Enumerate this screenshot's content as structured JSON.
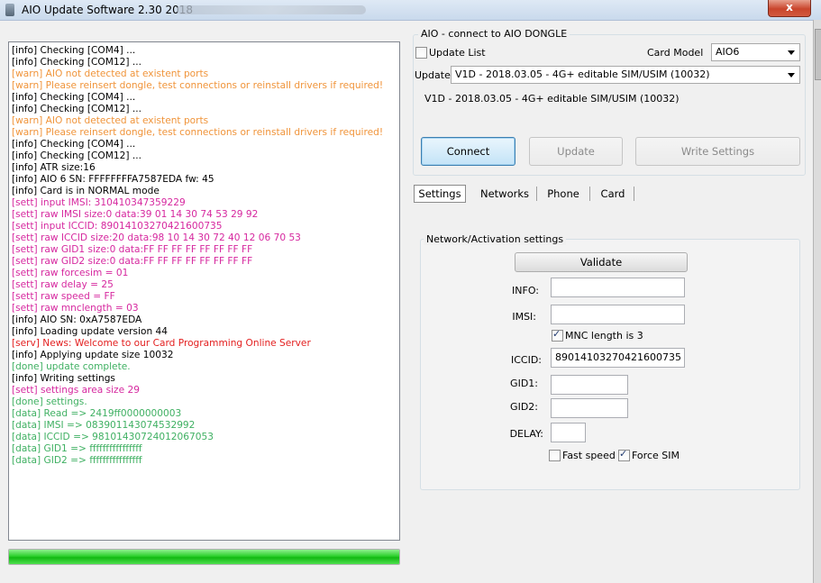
{
  "window": {
    "title": "AIO Update Software 2.30 2018",
    "close_label": "x"
  },
  "log": {
    "lines": [
      {
        "text": "[info] Checking [COM4] ...",
        "kind": "info"
      },
      {
        "text": "[info] Checking [COM12] ...",
        "kind": "info"
      },
      {
        "text": "[warn] AIO not detected at existent ports",
        "kind": "warn"
      },
      {
        "text": "[warn] Please reinsert dongle, test connections or reinstall drivers if required!",
        "kind": "warn"
      },
      {
        "text": "[info] Checking [COM4] ...",
        "kind": "info"
      },
      {
        "text": "[info] Checking [COM12] ...",
        "kind": "info"
      },
      {
        "text": "[warn] AIO not detected at existent ports",
        "kind": "warn"
      },
      {
        "text": "[warn] Please reinsert dongle, test connections or reinstall drivers if required!",
        "kind": "warn"
      },
      {
        "text": "[info] Checking [COM4] ...",
        "kind": "info"
      },
      {
        "text": "[info] Checking [COM12] ...",
        "kind": "info"
      },
      {
        "text": "[info] ATR size:16",
        "kind": "info"
      },
      {
        "text": "[info] AIO 6 SN: FFFFFFFFA7587EDA fw: 45",
        "kind": "info"
      },
      {
        "text": "[info] Card is in NORMAL mode",
        "kind": "info"
      },
      {
        "text": "[sett] input IMSI: 310410347359229",
        "kind": "sett"
      },
      {
        "text": "[sett] raw IMSI size:0 data:39 01 14 30 74 53 29 92",
        "kind": "sett"
      },
      {
        "text": "[sett] input ICCID: 89014103270421600735",
        "kind": "sett"
      },
      {
        "text": "[sett] raw ICCID size:20 data:98 10 14 30 72 40 12 06 70 53",
        "kind": "sett"
      },
      {
        "text": "[sett] raw GID1 size:0 data:FF FF FF FF FF FF FF FF",
        "kind": "sett"
      },
      {
        "text": "[sett] raw GID2 size:0 data:FF FF FF FF FF FF FF FF",
        "kind": "sett"
      },
      {
        "text": "[sett] raw forcesim = 01",
        "kind": "sett"
      },
      {
        "text": "[sett] raw delay = 25",
        "kind": "sett"
      },
      {
        "text": "[sett] raw speed = FF",
        "kind": "sett"
      },
      {
        "text": "[sett] raw mnclength = 03",
        "kind": "sett"
      },
      {
        "text": "[info] AIO SN: 0xA7587EDA",
        "kind": "info"
      },
      {
        "text": "[info] Loading update version 44",
        "kind": "info"
      },
      {
        "text": "[serv] News: Welcome to our Card Programming Online Server",
        "kind": "serv"
      },
      {
        "text": "[info] Applying update size 10032",
        "kind": "info"
      },
      {
        "text": "[done] update complete.",
        "kind": "done"
      },
      {
        "text": "[info] Writing settings",
        "kind": "info"
      },
      {
        "text": "[sett] settings area size 29",
        "kind": "sett"
      },
      {
        "text": "[done] settings.",
        "kind": "done"
      },
      {
        "text": "[data] Read => 2419ff0000000003",
        "kind": "data"
      },
      {
        "text": "[data] IMSI => 083901143074532992",
        "kind": "data"
      },
      {
        "text": "[data] ICCID => 98101430724012067053",
        "kind": "data"
      },
      {
        "text": "[data] GID1 => ffffffffffffffff",
        "kind": "data"
      },
      {
        "text": "[data] GID2 => ffffffffffffffff",
        "kind": "data"
      }
    ]
  },
  "progress": {
    "value_percent": 100
  },
  "connect_group": {
    "title": "AIO - connect to AIO DONGLE",
    "update_list_label": "Update List",
    "update_list_checked": false,
    "card_model_label": "Card Model",
    "card_model_value": "AIO6",
    "update_label": "Update",
    "update_value": "V1D - 2018.03.05 - 4G+ editable SIM/USIM (10032)",
    "update_description": "V1D - 2018.03.05 - 4G+ editable SIM/USIM (10032)",
    "connect_button": "Connect",
    "update_button": "Update",
    "write_settings_button": "Write Settings"
  },
  "tabs": [
    {
      "label": "Settings",
      "active": true
    },
    {
      "label": "Networks",
      "active": false
    },
    {
      "label": "Phone",
      "active": false
    },
    {
      "label": "Card",
      "active": false
    }
  ],
  "network_group": {
    "title": "Network/Activation settings",
    "validate_button": "Validate",
    "info_label": "INFO:",
    "info_value": "",
    "imsi_label": "IMSI:",
    "imsi_value": "",
    "mnc_label": "MNC length is 3",
    "mnc_checked": true,
    "iccid_label": "ICCID:",
    "iccid_value": "89014103270421600735",
    "gid1_label": "GID1:",
    "gid1_value": "",
    "gid2_label": "GID2:",
    "gid2_value": "",
    "delay_label": "DELAY:",
    "delay_value": "",
    "fast_speed_label": "Fast speed",
    "fast_speed_checked": false,
    "force_sim_label": "Force SIM",
    "force_sim_checked": true
  },
  "colors": {
    "info": "#000000",
    "warn": "#f0943a",
    "sett": "#d6289f",
    "serv": "#e32020",
    "done": "#3fb062",
    "data": "#3fb062",
    "progress": "#12b812"
  }
}
